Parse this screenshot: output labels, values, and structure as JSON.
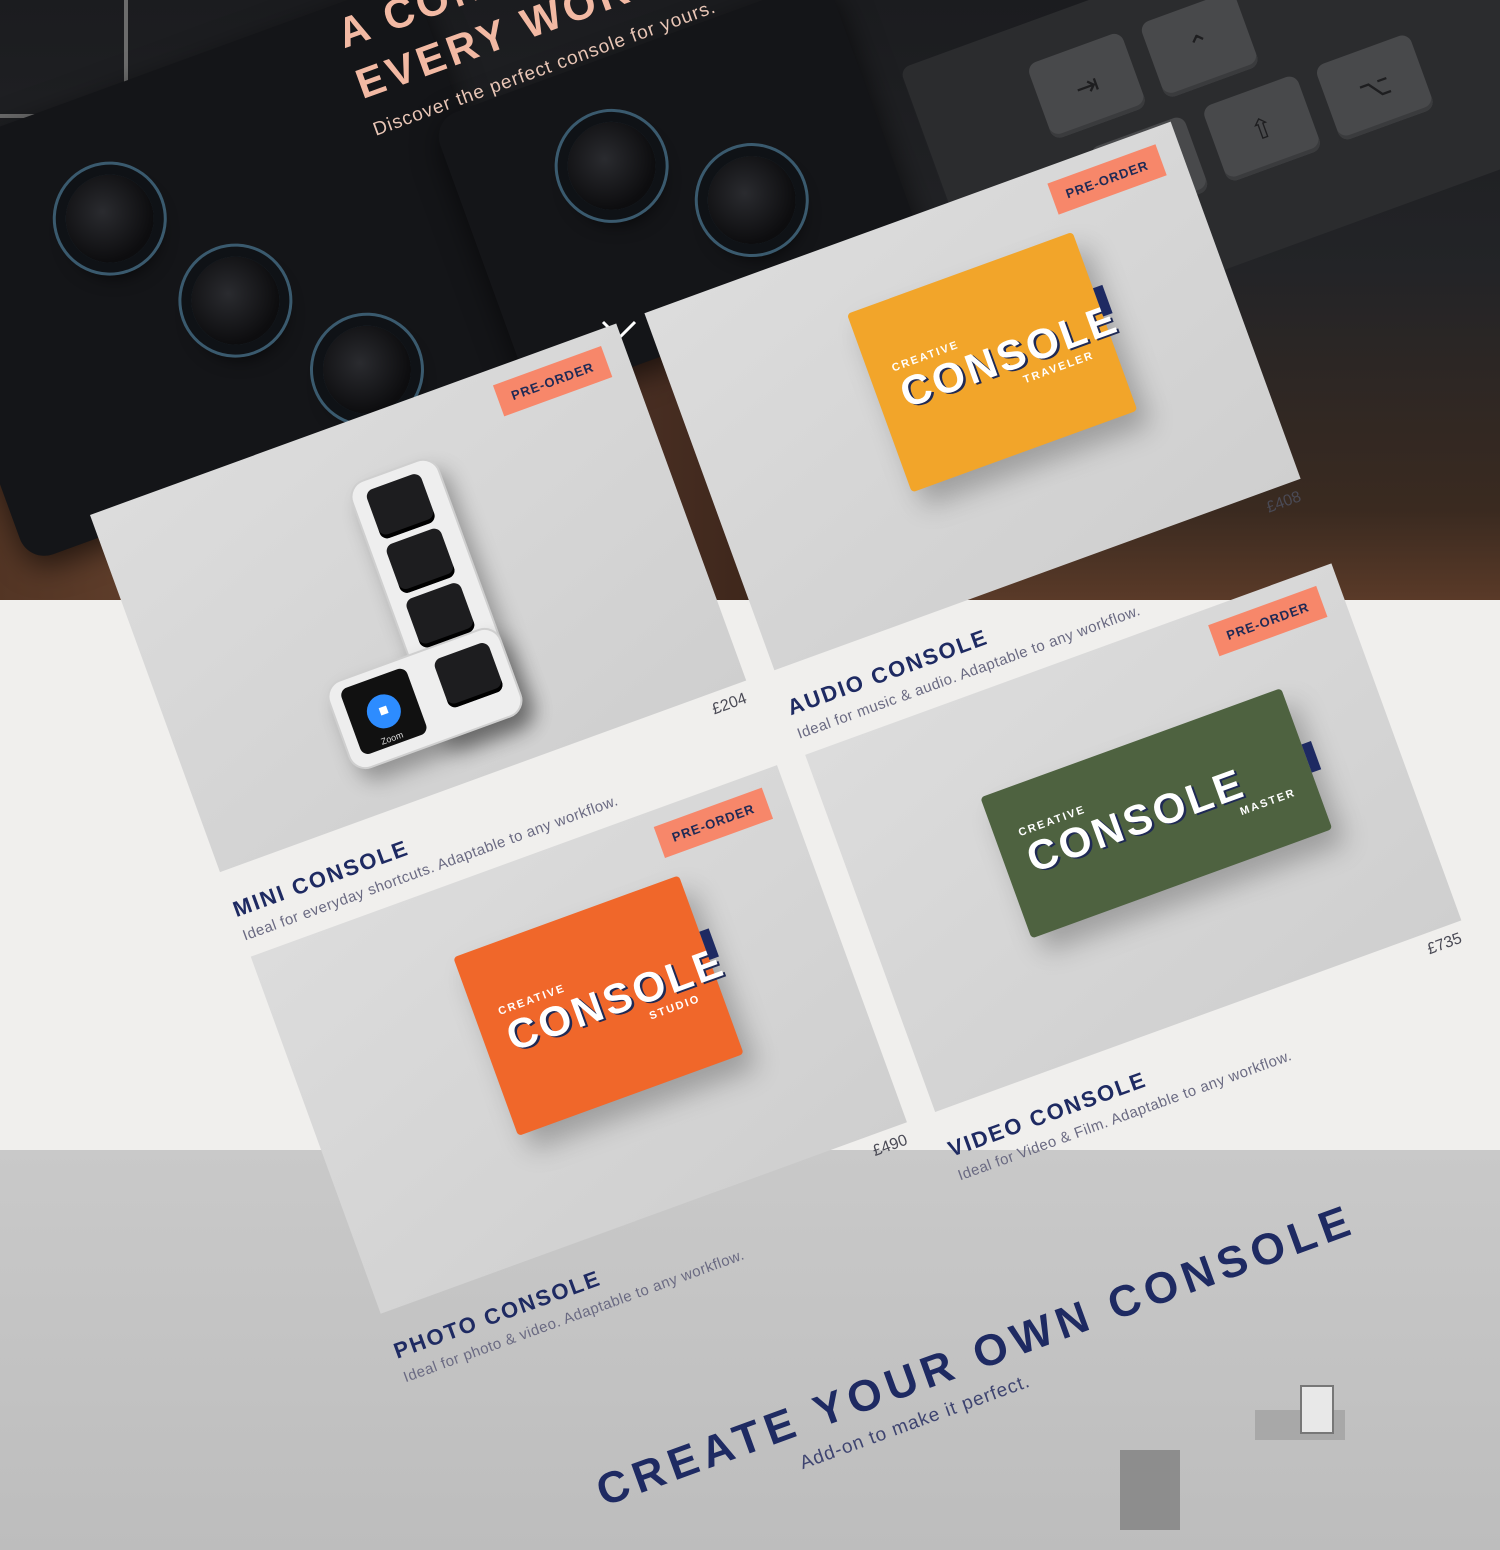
{
  "hero": {
    "title_line1": "A CONSOLE",
    "title_line2": "EVERY WORKFLOW",
    "subtitle": "Discover the perfect console for yours."
  },
  "products": [
    {
      "name": "MINI CONSOLE",
      "desc": "Ideal for everyday shortcuts. Adaptable to any workflow.",
      "price": "£204",
      "badge": "PRE-ORDER",
      "device_label": "Zoom"
    },
    {
      "name": "AUDIO CONSOLE",
      "desc": "Ideal for music & audio. Adaptable to any workflow.",
      "price": "£408",
      "badge": "PRE-ORDER",
      "box": {
        "small": "CREATIVE",
        "big": "CONSOLE",
        "edition": "TRAVELER",
        "color": "#f2a52a"
      }
    },
    {
      "name": "PHOTO CONSOLE",
      "desc": "Ideal for photo & video. Adaptable to any workflow.",
      "price": "£490",
      "badge": "PRE-ORDER",
      "box": {
        "small": "CREATIVE",
        "big": "CONSOLE",
        "edition": "STUDIO",
        "color": "#f0672a"
      }
    },
    {
      "name": "VIDEO CONSOLE",
      "desc": "Ideal for Video & Film. Adaptable to any workflow.",
      "price": "£735",
      "badge": "PRE-ORDER",
      "box": {
        "small": "CREATIVE",
        "big": "CONSOLE",
        "edition": "MASTER",
        "color": "#4e6240"
      }
    }
  ],
  "create": {
    "title": "CREATE YOUR OWN CONSOLE",
    "subtitle": "Add-on to make it perfect."
  },
  "colors": {
    "accent": "#f7876a",
    "navy": "#1e2a62",
    "hero_text": "#f2b9a3"
  }
}
